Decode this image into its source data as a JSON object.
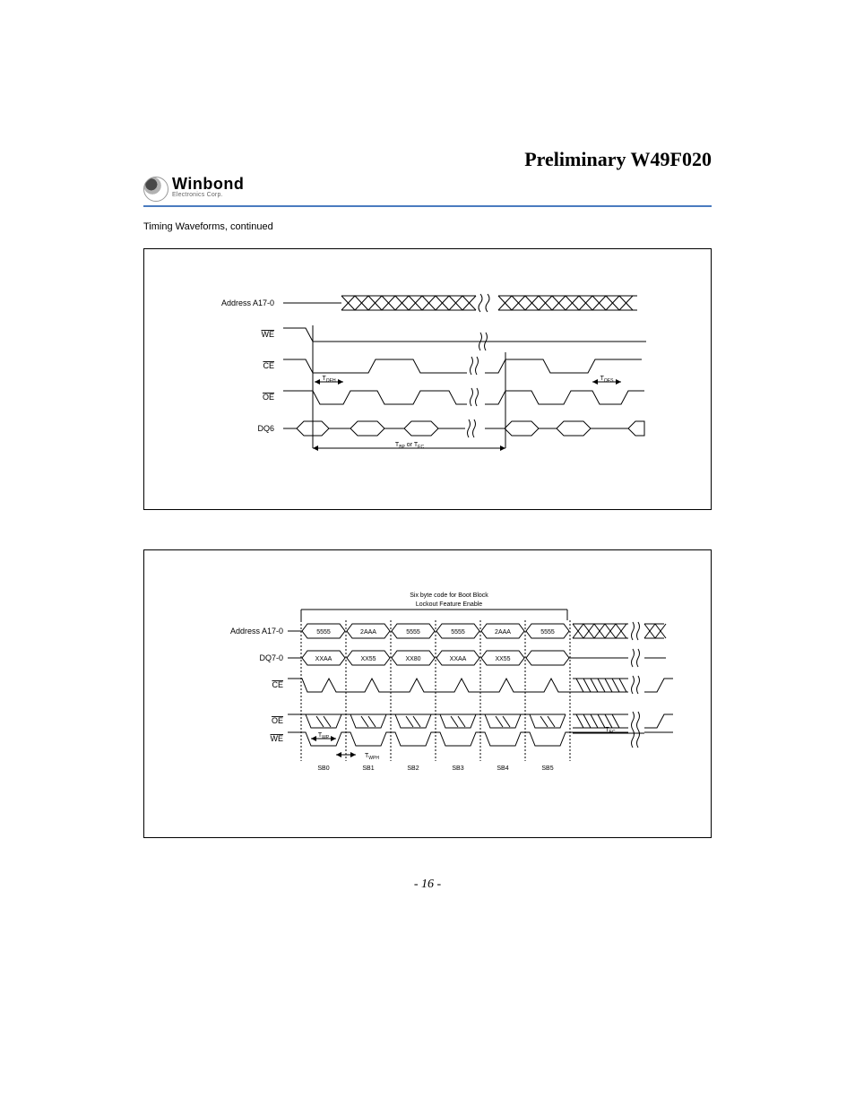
{
  "header": {
    "title": "Preliminary W49F020"
  },
  "logo": {
    "main": "Winbond",
    "sub": "Electronics Corp."
  },
  "caption": "Timing Waveforms, continued",
  "page_number": "- 16 -",
  "fig1": {
    "signals": {
      "addr": "Address A17-0",
      "we": "WE",
      "ce": "CE",
      "oe": "OE",
      "dq6": "DQ6"
    },
    "timing": {
      "toeh": "TOEH",
      "toes": "TOES",
      "tbp_tec": "TBP or TEC"
    }
  },
  "fig2": {
    "caption1": "Six byte code for Boot Block",
    "caption2": "Lockout Feature Enable",
    "signals": {
      "addr": "Address A17-0",
      "dq70": "DQ7-0",
      "ce": "CE",
      "oe": "OE",
      "we": "WE"
    },
    "addr_vals": [
      "5555",
      "2AAA",
      "5555",
      "5555",
      "2AAA",
      "5555"
    ],
    "data_vals": [
      "XXAA",
      "XX55",
      "XX80",
      "XXAA",
      "XX55"
    ],
    "sb_labels": [
      "SB0",
      "SB1",
      "SB2",
      "SB3",
      "SB4",
      "SB5"
    ],
    "timing": {
      "twp": "TWP",
      "twph": "TWPH",
      "tec": "TEC"
    }
  }
}
